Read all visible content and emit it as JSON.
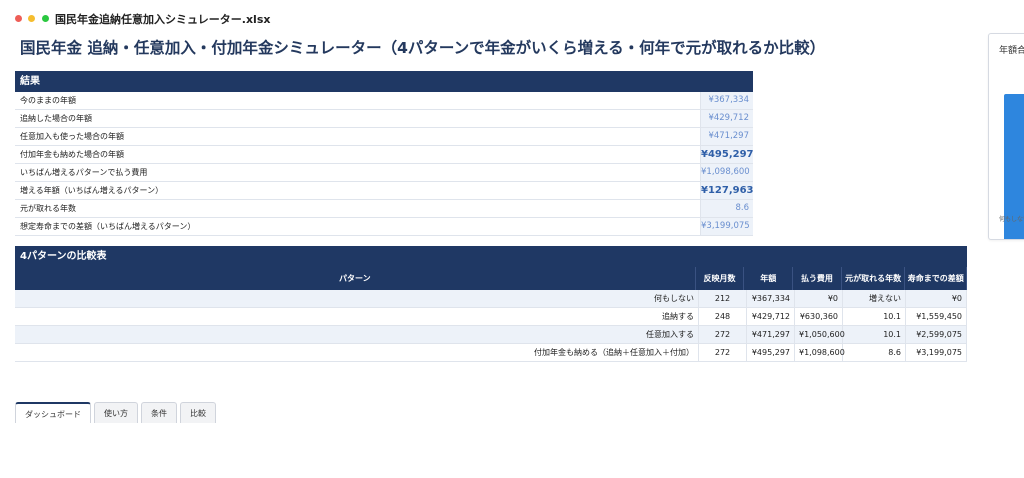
{
  "window": {
    "title": "国民年金追納任意加入シミュレーター.xlsx"
  },
  "page_title": "国民年金 追納・任意加入・付加年金シミュレーター（4パターンで年金がいくら増える・何年で元が取れるか比較）",
  "results": {
    "header": "結果",
    "rows": [
      {
        "label": "今のままの年額",
        "value": "¥367,334"
      },
      {
        "label": "追納した場合の年額",
        "value": "¥429,712"
      },
      {
        "label": "任意加入も使った場合の年額",
        "value": "¥471,297"
      },
      {
        "label": "付加年金も納めた場合の年額",
        "value": "¥495,297"
      },
      {
        "label": "いちばん増えるパターンで払う費用",
        "value": "¥1,098,600"
      },
      {
        "label": "増える年額（いちばん増えるパターン）",
        "value": "¥127,963"
      },
      {
        "label": "元が取れる年数",
        "value": "8.6"
      },
      {
        "label": "想定寿命までの差額（いちばん増えるパターン）",
        "value": "¥3,199,075"
      }
    ]
  },
  "comparison": {
    "header": "4パターンの比較表",
    "columns": [
      "パターン",
      "反映月数",
      "年額",
      "払う費用",
      "元が取れる年数",
      "寿命までの差額"
    ],
    "rows": [
      {
        "pattern": "何もしない",
        "months": "212",
        "annual": "¥367,334",
        "cost": "¥0",
        "years": "増えない",
        "diff": "¥0"
      },
      {
        "pattern": "追納する",
        "months": "248",
        "annual": "¥429,712",
        "cost": "¥630,360",
        "years": "10.1",
        "diff": "¥1,559,450"
      },
      {
        "pattern": "任意加入する",
        "months": "272",
        "annual": "¥471,297",
        "cost": "¥1,050,600",
        "years": "10.1",
        "diff": "¥2,599,075"
      },
      {
        "pattern": "付加年金も納める（追納＋任意加入＋付加）",
        "months": "272",
        "annual": "¥495,297",
        "cost": "¥1,098,600",
        "years": "8.6",
        "diff": "¥3,199,075"
      }
    ]
  },
  "chart_panel": {
    "title": "年額合",
    "xlabel": "何もしない"
  },
  "tabs": [
    {
      "label": "ダッシュボード",
      "active": true
    },
    {
      "label": "使い方",
      "active": false
    },
    {
      "label": "条件",
      "active": false
    },
    {
      "label": "比較",
      "active": false
    }
  ],
  "colors": {
    "header_bg": "#1f3864",
    "value_bg": "#edf2f9",
    "value_text": "#6a8fcf",
    "value_emphasis": "#2f5fa8",
    "bar": "#2e86de"
  }
}
